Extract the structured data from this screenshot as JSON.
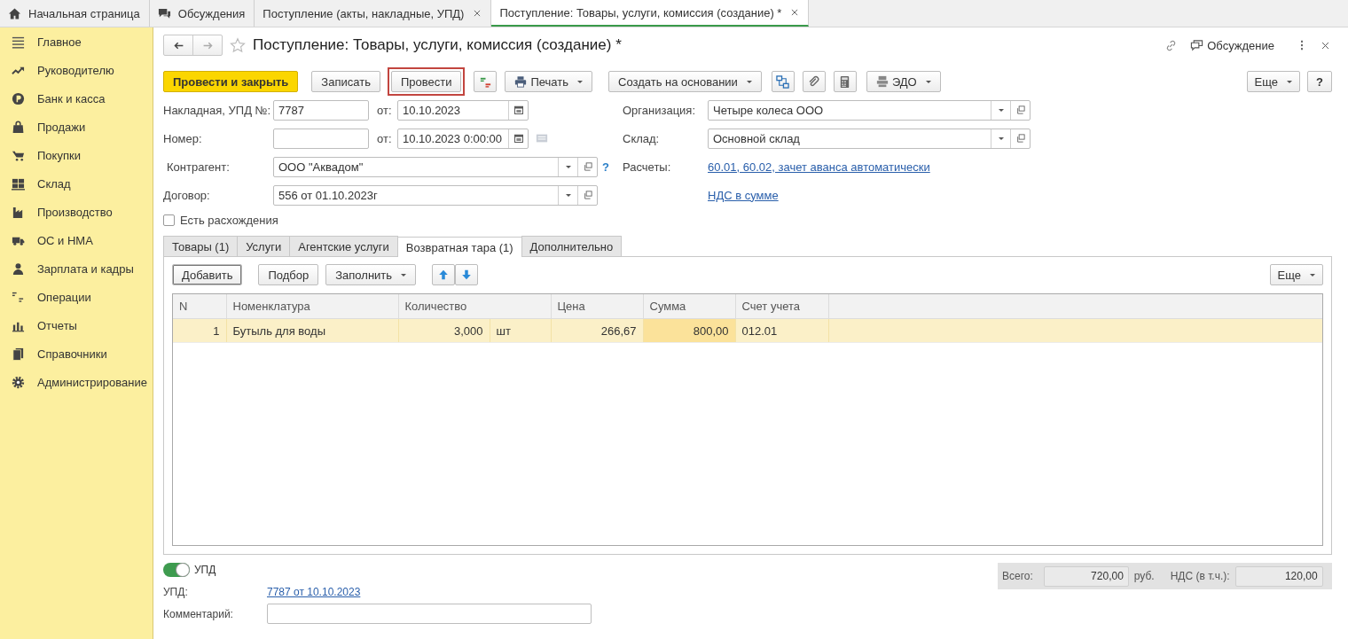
{
  "top_tabs": [
    {
      "label": "Начальная страница",
      "closable": false,
      "selected": false
    },
    {
      "label": "Обсуждения",
      "closable": false,
      "selected": false
    },
    {
      "label": "Поступление (акты, накладные, УПД)",
      "closable": true,
      "selected": false
    },
    {
      "label": "Поступление: Товары, услуги, комиссия (создание) *",
      "closable": true,
      "selected": true
    }
  ],
  "sidebar": {
    "items": [
      {
        "label": "Главное"
      },
      {
        "label": "Руководителю"
      },
      {
        "label": "Банк и касса"
      },
      {
        "label": "Продажи"
      },
      {
        "label": "Покупки"
      },
      {
        "label": "Склад"
      },
      {
        "label": "Производство"
      },
      {
        "label": "ОС и НМА"
      },
      {
        "label": "Зарплата и кадры"
      },
      {
        "label": "Операции"
      },
      {
        "label": "Отчеты"
      },
      {
        "label": "Справочники"
      },
      {
        "label": "Администрирование"
      }
    ]
  },
  "document": {
    "title": "Поступление: Товары, услуги, комиссия (создание) *",
    "favorite": false,
    "discussion": "Обсуждение"
  },
  "toolbar": [
    {
      "kind": "button",
      "label": "Провести и закрыть",
      "primary": true,
      "highlighted": false
    },
    {
      "kind": "button",
      "label": "Записать",
      "primary": false,
      "highlighted": false
    },
    {
      "kind": "button",
      "label": "Провести",
      "primary": false,
      "highlighted": true
    },
    {
      "kind": "icon"
    },
    {
      "kind": "menu",
      "label": "Печать"
    },
    {
      "kind": "menu",
      "label": "Создать на основании"
    },
    {
      "kind": "icon"
    },
    {
      "kind": "icon"
    },
    {
      "kind": "icon"
    },
    {
      "kind": "menu",
      "label": "ЭДО"
    }
  ],
  "toolbar_right": {
    "more": "Еще",
    "help": "?"
  },
  "form": {
    "invoice": {
      "label": "Накладная, УПД №:",
      "value": "7787",
      "date_label": "от:",
      "date": "10.10.2023"
    },
    "number": {
      "label": "Номер:",
      "date_label": "от:",
      "date": "10.10.2023 0:00:00"
    },
    "counterparty": {
      "label": "Контрагент:",
      "value": "ООО \"Аквадом\"",
      "help": "?"
    },
    "contract": {
      "label": "Договор:",
      "value": "556 от 01.10.2023г"
    },
    "discrepancies": {
      "label": "Есть расхождения",
      "checked": false
    },
    "organization": {
      "label": "Организация:",
      "value": "Четыре колеса ООО"
    },
    "warehouse": {
      "label": "Склад:",
      "value": "Основной склад"
    },
    "settlements": {
      "label": "Расчеты:",
      "link": "60.01, 60.02, зачет аванса автоматически"
    },
    "vat_link": "НДС в сумме"
  },
  "tabs": [
    {
      "label": "Товары (1)",
      "selected": false
    },
    {
      "label": "Услуги",
      "selected": false
    },
    {
      "label": "Агентские услуги",
      "selected": false
    },
    {
      "label": "Возвратная тара (1)",
      "selected": true
    },
    {
      "label": "Дополнительно",
      "selected": false
    }
  ],
  "table_toolbar": [
    {
      "kind": "button",
      "label": "Добавить",
      "focused": true
    },
    {
      "kind": "button",
      "label": "Подбор",
      "focused": false
    },
    {
      "kind": "menu",
      "label": "Заполнить",
      "focused": false
    },
    {
      "kind": "move-up",
      "focused": false
    },
    {
      "kind": "move-down",
      "focused": false
    }
  ],
  "table_more": "Еще",
  "table": {
    "columns": [
      {
        "label": "N"
      },
      {
        "label": "Номенклатура"
      },
      {
        "label": "Количество",
        "colspan": 2
      },
      {
        "label": "Цена"
      },
      {
        "label": "Сумма"
      },
      {
        "label": "Счет учета"
      }
    ],
    "rows": [
      {
        "selected": true,
        "cells": [
          {
            "text": "1",
            "active": false
          },
          {
            "text": "Бутыль для воды",
            "active": false
          },
          {
            "text": "3,000",
            "active": false
          },
          {
            "text": "шт",
            "active": false
          },
          {
            "text": "266,67",
            "active": false
          },
          {
            "text": "800,00",
            "active": true
          },
          {
            "text": "012.01",
            "active": false
          }
        ]
      }
    ]
  },
  "footer": {
    "upd_toggle": {
      "label": "УПД",
      "on": true
    },
    "upd": {
      "label": "УПД:",
      "link": "7787 от 10.10.2023"
    },
    "comment": {
      "label": "Комментарий:"
    },
    "totals": {
      "total_label": "Всего:",
      "total": "720,00",
      "currency": "руб.",
      "vat_label": "НДС (в т.ч.):",
      "vat": "120,00"
    }
  }
}
